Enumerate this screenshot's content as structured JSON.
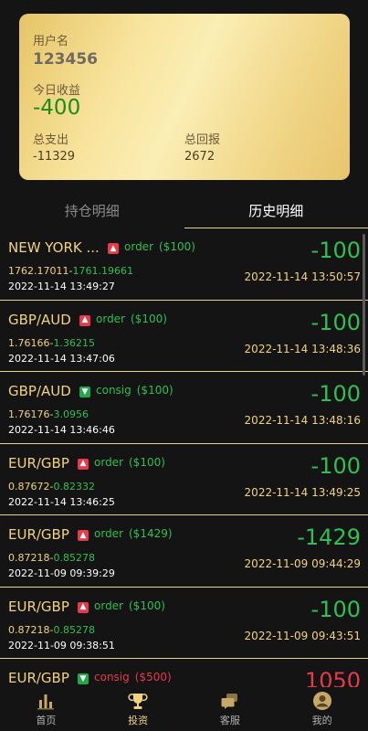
{
  "card": {
    "username_label": "用户名",
    "username": "123456",
    "today_profit_label": "今日收益",
    "today_profit": "-400",
    "total_expense_label": "总支出",
    "total_expense": "-11329",
    "total_return_label": "总回报",
    "total_return": "2672"
  },
  "tabs": [
    {
      "label": "持仓明细"
    },
    {
      "label": "历史明细"
    }
  ],
  "orders": [
    {
      "symbol": "NEW YORK ...",
      "direction": "up",
      "type": "order",
      "stake": "($100)",
      "open_price": "1762.17011",
      "close_price": "1761.19661",
      "open_time": "2022-11-14 13:49:27",
      "amount": "-100",
      "close_time": "2022-11-14 13:50:57"
    },
    {
      "symbol": "GBP/AUD",
      "direction": "up",
      "type": "order",
      "stake": "($100)",
      "open_price": "1.76166",
      "close_price": "1.36215",
      "open_time": "2022-11-14 13:47:06",
      "amount": "-100",
      "close_time": "2022-11-14 13:48:36"
    },
    {
      "symbol": "GBP/AUD",
      "direction": "down",
      "type": "consig",
      "stake": "($100)",
      "open_price": "1.76176",
      "close_price": "3.0956",
      "open_time": "2022-11-14 13:46:46",
      "amount": "-100",
      "close_time": "2022-11-14 13:48:16"
    },
    {
      "symbol": "EUR/GBP",
      "direction": "up",
      "type": "order",
      "stake": "($100)",
      "open_price": "0.87672",
      "close_price": "0.82332",
      "open_time": "2022-11-14 13:46:25",
      "amount": "-100",
      "close_time": "2022-11-14 13:49:25"
    },
    {
      "symbol": "EUR/GBP",
      "direction": "up",
      "type": "order",
      "stake": "($1429)",
      "open_price": "0.87218",
      "close_price": "0.85278",
      "open_time": "2022-11-09 09:39:29",
      "amount": "-1429",
      "close_time": "2022-11-09 09:44:29"
    },
    {
      "symbol": "EUR/GBP",
      "direction": "up",
      "type": "order",
      "stake": "($100)",
      "open_price": "0.87218",
      "close_price": "0.85278",
      "open_time": "2022-11-09 09:38:51",
      "amount": "-100",
      "close_time": "2022-11-09 09:43:51"
    },
    {
      "symbol": "EUR/GBP",
      "direction": "down",
      "type": "consig",
      "stake": "($500)",
      "open_price": "",
      "close_price": "",
      "open_time": "",
      "amount": "1050",
      "close_time": ""
    }
  ],
  "nav": [
    {
      "label": "首页",
      "icon": "bar-chart-icon"
    },
    {
      "label": "投资",
      "icon": "trophy-icon"
    },
    {
      "label": "客服",
      "icon": "chat-icon"
    },
    {
      "label": "我的",
      "icon": "user-avatar-icon"
    }
  ],
  "colors": {
    "accent_gold": "#f2d37c",
    "profit_green": "#2fbf54",
    "loss_red": "#e8394a",
    "background": "#141414"
  }
}
